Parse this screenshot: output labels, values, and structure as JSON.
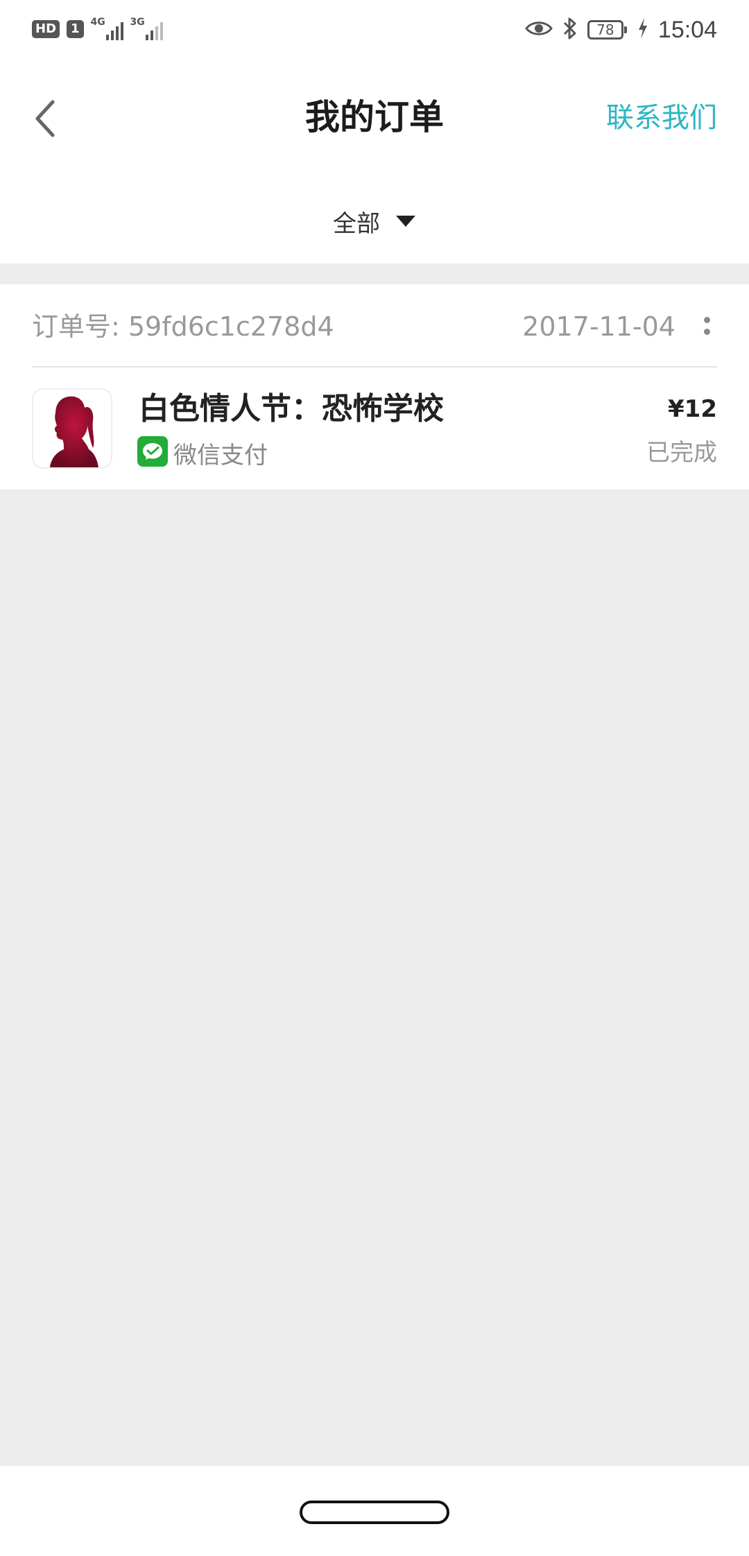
{
  "status_bar": {
    "hd_label": "HD",
    "sim_label": "1",
    "network1": "4G",
    "network2": "3G",
    "battery_level": "78",
    "time": "15:04",
    "icons": [
      "eye-icon",
      "bluetooth-icon",
      "battery-icon",
      "charging-icon"
    ]
  },
  "header": {
    "title": "我的订单",
    "contact_label": "联系我们",
    "accent_color": "#2bb6c4"
  },
  "filter": {
    "selected": "全部"
  },
  "orders": [
    {
      "number_label": "订单号: 59fd6c1c278d4",
      "date": "2017-11-04",
      "product_name": "白色情人节：恐怖学校",
      "payment_method": "微信支付",
      "price": "¥12",
      "status": "已完成",
      "thumbnail_icon": "girl-silhouette-icon",
      "payment_icon": "wechat-pay-icon"
    }
  ]
}
